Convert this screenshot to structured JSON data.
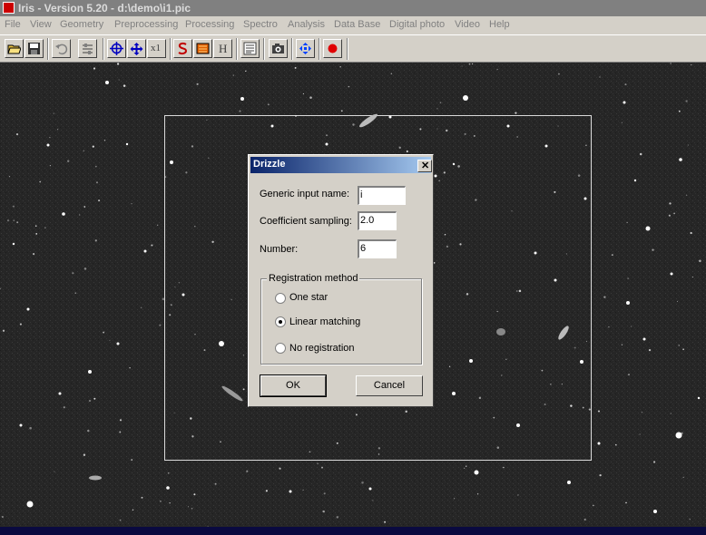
{
  "window": {
    "title": "Iris - Version 5.20 - d:\\demo\\i1.pic"
  },
  "menu": [
    "File",
    "View",
    "Geometry",
    "Preprocessing",
    "Processing",
    "Spectro",
    "Analysis",
    "Data Base",
    "Digital photo",
    "Video",
    "Help"
  ],
  "toolbar": {
    "x1_label": "x1",
    "h_label": "H",
    "icons": [
      "open-folder-icon",
      "save-disk-icon",
      "undo-icon",
      "adjust-icon",
      "crosshair-target-icon",
      "move-arrows-icon",
      "zoom-x1",
      "s-spiral-icon",
      "palette-icon",
      "h-icon",
      "list-icon",
      "camera-icon",
      "blue-arrows-icon",
      "record-dot-icon"
    ]
  },
  "dialog": {
    "title": "Drizzle",
    "close_glyph": "✕",
    "generic_input_label": "Generic input name:",
    "generic_input_value": "i",
    "coef_label": "Coefficient sampling:",
    "coef_value": "2.0",
    "number_label": "Number:",
    "number_value": "6",
    "group_label": "Registration method",
    "options": [
      {
        "label": "One star",
        "selected": false
      },
      {
        "label": "Linear matching",
        "selected": true
      },
      {
        "label": "No registration",
        "selected": false
      }
    ],
    "ok_label": "OK",
    "cancel_label": "Cancel"
  }
}
